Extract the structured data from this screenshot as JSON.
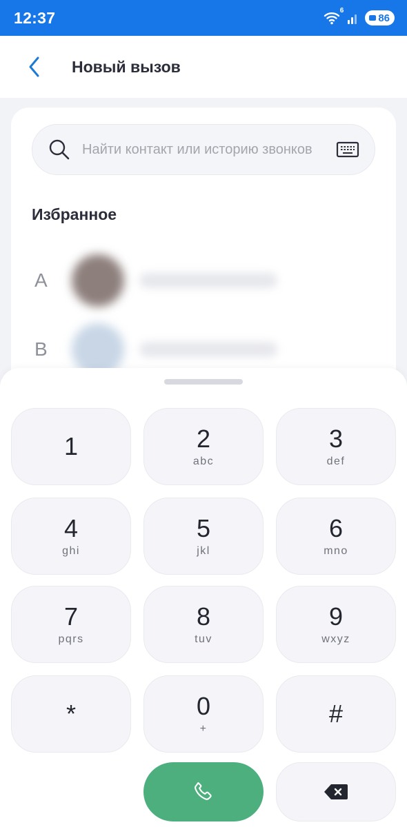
{
  "status_bar": {
    "time": "12:37",
    "wifi_badge": "6",
    "battery": "86",
    "icons": [
      "wifi-icon",
      "signal-icon",
      "battery-icon"
    ]
  },
  "header": {
    "title": "Новый вызов",
    "back_icon": "chevron-left-icon"
  },
  "search": {
    "placeholder": "Найти контакт или историю звонков",
    "value": "",
    "icon": "search-icon",
    "keyboard_icon": "keyboard-icon"
  },
  "favorites": {
    "title": "Избранное",
    "contacts": [
      {
        "letter": "А"
      },
      {
        "letter": "В"
      }
    ]
  },
  "keypad": {
    "keys": [
      {
        "digit": "1",
        "letters": ""
      },
      {
        "digit": "2",
        "letters": "abc"
      },
      {
        "digit": "3",
        "letters": "def"
      },
      {
        "digit": "4",
        "letters": "ghi"
      },
      {
        "digit": "5",
        "letters": "jkl"
      },
      {
        "digit": "6",
        "letters": "mno"
      },
      {
        "digit": "7",
        "letters": "pqrs"
      },
      {
        "digit": "8",
        "letters": "tuv"
      },
      {
        "digit": "9",
        "letters": "wxyz"
      },
      {
        "digit": "*",
        "letters": ""
      },
      {
        "digit": "0",
        "letters": "+"
      },
      {
        "digit": "#",
        "letters": ""
      }
    ],
    "call_icon": "phone-icon",
    "delete_icon": "backspace-icon"
  },
  "colors": {
    "status_bar": "#1877e8",
    "accent": "#1877e8",
    "call_button": "#4caf7d",
    "key_background": "#f5f5f9"
  }
}
